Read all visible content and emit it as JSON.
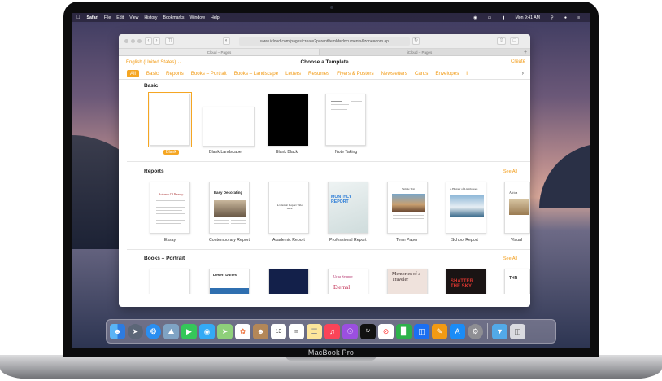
{
  "device": {
    "brand_label": "MacBook Pro"
  },
  "menubar": {
    "app": "Safari",
    "items": [
      "File",
      "Edit",
      "View",
      "History",
      "Bookmarks",
      "Window",
      "Help"
    ],
    "clock": "Mon 9:41 AM"
  },
  "browser": {
    "url": "www.icloud.com/pages/create?parentItemId=documents&zone=com.ap",
    "tabs": [
      {
        "label": "iCloud – Pages"
      },
      {
        "label": "iCloud – Pages"
      }
    ]
  },
  "chooser": {
    "language": "English (United States) ⌄",
    "title": "Choose a Template",
    "create": "Create",
    "categories": [
      "All",
      "Basic",
      "Reports",
      "Books – Portrait",
      "Books – Landscape",
      "Letters",
      "Resumes",
      "Flyers & Posters",
      "Newsletters",
      "Cards",
      "Envelopes",
      "I"
    ],
    "selected_category": "All",
    "sections": {
      "basic": {
        "title": "Basic",
        "templates": [
          {
            "name": "Blank",
            "selected": true
          },
          {
            "name": "Blank Landscape"
          },
          {
            "name": "Blank Black"
          },
          {
            "name": "Note Taking"
          }
        ]
      },
      "reports": {
        "title": "Reports",
        "see_all": "See All",
        "templates": [
          {
            "name": "Essay",
            "cover": "Autumn Of Beauty"
          },
          {
            "name": "Contemporary Report",
            "cover": "Easy Decorating"
          },
          {
            "name": "Academic Report",
            "cover": "Academic Report Title Here"
          },
          {
            "name": "Professional Report",
            "cover": "MONTHLY REPORT"
          },
          {
            "name": "Term Paper",
            "cover": "Sample Text"
          },
          {
            "name": "School Report",
            "cover": "A History of Lighthouses"
          },
          {
            "name": "Visual",
            "cover": "Africa"
          }
        ]
      },
      "books": {
        "title": "Books – Portrait",
        "see_all": "See All",
        "covers": [
          "",
          "Desert Dunes",
          "",
          "Urna Semper",
          "Memories of a Traveler",
          "SHATTER THE SKY",
          "THR"
        ],
        "cover_subtitle": "Eternal"
      }
    }
  },
  "dock": {
    "icons": [
      "finder-icon",
      "launchpad-icon",
      "safari-icon",
      "photos-icon",
      "facetime-icon",
      "messages-icon",
      "maps-icon",
      "photos-app-icon",
      "contacts-icon",
      "calendar-icon",
      "reminders-icon",
      "notes-icon",
      "music-icon",
      "podcasts-icon",
      "tv-icon",
      "news-icon",
      "numbers-icon",
      "keynote-icon",
      "pages-icon",
      "app-store-icon",
      "system-preferences-icon",
      "downloads-folder-icon",
      "trash-icon"
    ],
    "calendar_date": "13",
    "tv_label": "tv"
  }
}
